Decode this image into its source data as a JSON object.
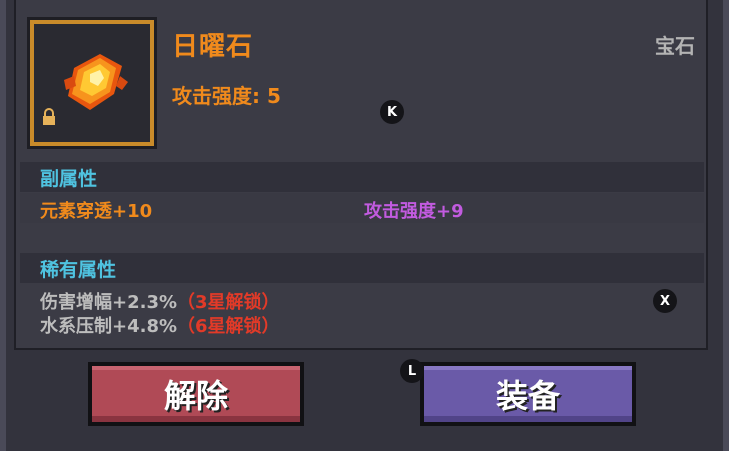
{
  "item": {
    "name": "日曜石",
    "type": "宝石",
    "main_stat": "攻击强度: 5"
  },
  "sections": {
    "secondary_title": "副属性",
    "secondary_stats": [
      "元素穿透+10",
      "攻击强度+9"
    ],
    "rare_title": "稀有属性",
    "rare_stats": [
      {
        "text": "伤害增幅+2.3%",
        "lock": "（3星解锁）"
      },
      {
        "text": "水系压制+4.8%",
        "lock": "（6星解锁）"
      }
    ]
  },
  "keys": {
    "k": "K",
    "x": "X",
    "l": "L"
  },
  "buttons": {
    "remove": "解除",
    "equip": "装备"
  },
  "colors": {
    "accent_orange": "#f08a1c",
    "section_cyan": "#4fc3e0",
    "purple": "#c25be0",
    "lock_red": "#e23a28",
    "remove_button": "#b04a56",
    "equip_button": "#6a5aa8"
  },
  "icons": {
    "item": "sunstone-gem-icon",
    "lock": "lock-icon"
  }
}
